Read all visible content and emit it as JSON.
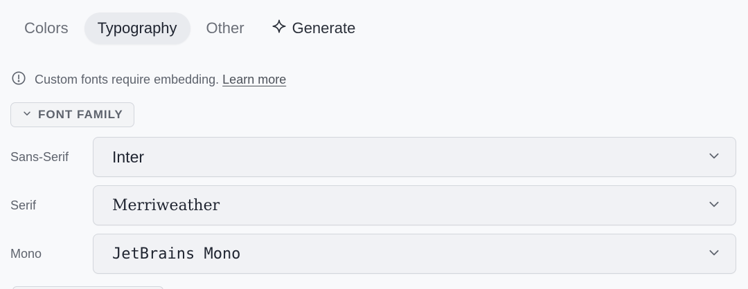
{
  "tabs": [
    {
      "label": "Colors",
      "active": false
    },
    {
      "label": "Typography",
      "active": true
    },
    {
      "label": "Other",
      "active": false
    },
    {
      "label": "Generate",
      "icon": "sparkle-icon",
      "active": false
    }
  ],
  "info": {
    "icon": "info-icon",
    "text": "Custom fonts require embedding.",
    "link": "Learn more"
  },
  "section": {
    "label": "FONT FAMILY",
    "icon": "chevron-down-icon",
    "expanded": true
  },
  "fonts": {
    "sans": {
      "label": "Sans-Serif",
      "value": "Inter"
    },
    "serif": {
      "label": "Serif",
      "value": "Merriweather"
    },
    "mono": {
      "label": "Mono",
      "value": "JetBrains Mono"
    }
  },
  "colors": {
    "background": "#f8f9fb",
    "tab_active_bg": "#e9ebef",
    "text": "#1f2430",
    "muted": "#5e636d",
    "border": "#d3d6dc"
  }
}
